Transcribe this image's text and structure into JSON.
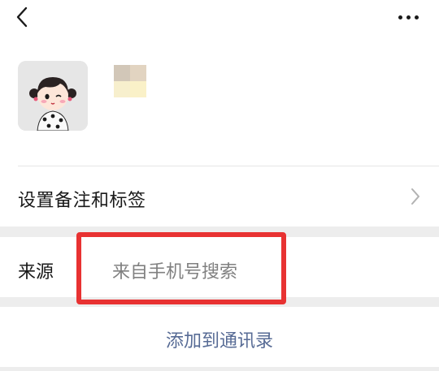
{
  "navbar": {
    "back_icon": "chevron-left-icon",
    "more_icon": "more-horizontal-icon"
  },
  "profile": {
    "avatar_icon": "avatar-cartoon-girl"
  },
  "remark_row": {
    "label": "设置备注和标签",
    "chevron_icon": "chevron-right-icon"
  },
  "source_row": {
    "label": "来源",
    "value": "来自手机号搜索",
    "highlight_color": "#e83232"
  },
  "add_contact": {
    "label": "添加到通讯录",
    "color": "#576b95"
  }
}
